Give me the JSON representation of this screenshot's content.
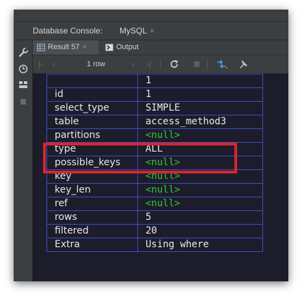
{
  "tabs": {
    "console_label": "Database Console:",
    "mysql_label": "MySQL",
    "close_glyph": "×"
  },
  "subtabs": {
    "result_label": "Result 57",
    "output_label": "Output"
  },
  "toolbar": {
    "row_count": "1 row"
  },
  "grid": {
    "header_value": "1",
    "rows": [
      {
        "key": "id",
        "value": "1"
      },
      {
        "key": "select_type",
        "value": "SIMPLE"
      },
      {
        "key": "table",
        "value": "access_method3"
      },
      {
        "key": "partitions",
        "value": "<null>"
      },
      {
        "key": "type",
        "value": "ALL"
      },
      {
        "key": "possible_keys",
        "value": "<null>"
      },
      {
        "key": "key",
        "value": "<null>"
      },
      {
        "key": "key_len",
        "value": "<null>"
      },
      {
        "key": "ref",
        "value": "<null>"
      },
      {
        "key": "rows",
        "value": "5"
      },
      {
        "key": "filtered",
        "value": "20"
      },
      {
        "key": "Extra",
        "value": "Using where"
      }
    ]
  },
  "colors": {
    "null_value": "#33c733",
    "grid_border": "#3f4fc6",
    "highlight": "#d8262d",
    "grid_bg": "#1d1c2b"
  },
  "icons": [
    "wrench-icon",
    "clock-icon",
    "layout-icon",
    "stop-icon",
    "table-icon",
    "output-icon",
    "first-page-icon",
    "prev-page-icon",
    "next-page-icon",
    "last-page-icon",
    "refresh-icon",
    "stop-query-icon",
    "transpose-icon",
    "pin-icon"
  ]
}
